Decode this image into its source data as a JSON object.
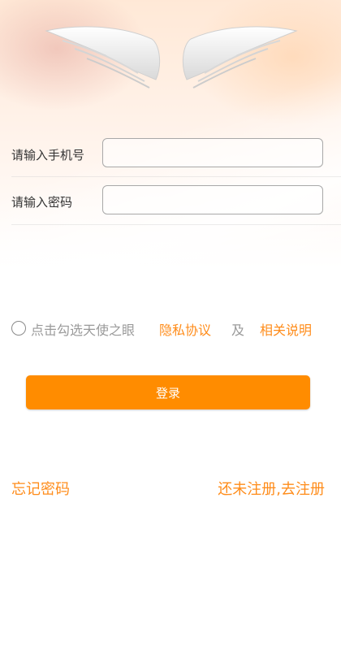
{
  "header": {
    "wings_icon": "angel-wings-icon"
  },
  "form": {
    "phone_label": "请输入手机号",
    "phone_value": "",
    "password_label": "请输入密码",
    "password_value": ""
  },
  "agreement": {
    "checkbox_text": "点击勾选天使之眼",
    "privacy_link": "隐私协议",
    "and_text": "及",
    "related_link": "相关说明",
    "checked": false
  },
  "actions": {
    "login_label": "登录",
    "forgot_password": "忘记密码",
    "register": "还未注册,去注册"
  },
  "colors": {
    "accent": "#ff8c00",
    "link": "#ff8c1a"
  }
}
